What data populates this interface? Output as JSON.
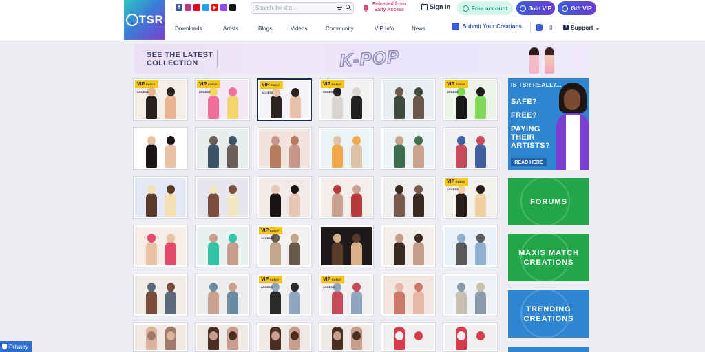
{
  "header": {
    "logo_text": "TSR",
    "search_placeholder": "Search the site...",
    "early_access": [
      "Released from",
      "Early Access"
    ],
    "sign_in": "Sign In",
    "free_account": "Free account",
    "join_vip": "Join VIP",
    "gift_vip": "Gift VIP",
    "nav": [
      "Downloads",
      "Artists",
      "Blogs",
      "Videos",
      "Community",
      "VIP Info",
      "News"
    ],
    "submit": "Submit Your Creations",
    "coins": "0",
    "support": "Support",
    "socials": [
      "facebook-icon",
      "instagram-icon",
      "pinterest-icon",
      "twitter-icon",
      "youtube-icon",
      "twitch-icon",
      "tiktok-icon"
    ]
  },
  "banner": {
    "line1": "SEE THE LATEST",
    "line2": "COLLECTION",
    "title": "K-POP"
  },
  "tiles": [
    {
      "vip": true
    },
    {
      "vip": true
    },
    {
      "vip": true,
      "selected": true
    },
    {
      "vip": true
    },
    {
      "vip": false
    },
    {
      "vip": true
    },
    {
      "vip": false
    },
    {
      "vip": false
    },
    {
      "vip": false
    },
    {
      "vip": false
    },
    {
      "vip": false
    },
    {
      "vip": false
    },
    {
      "vip": false
    },
    {
      "vip": false
    },
    {
      "vip": false
    },
    {
      "vip": false
    },
    {
      "vip": false
    },
    {
      "vip": true
    },
    {
      "vip": false
    },
    {
      "vip": false
    },
    {
      "vip": true
    },
    {
      "vip": false
    },
    {
      "vip": false
    },
    {
      "vip": false
    },
    {
      "vip": false
    },
    {
      "vip": false
    },
    {
      "vip": true
    },
    {
      "vip": true
    },
    {
      "vip": false
    },
    {
      "vip": false
    },
    {
      "vip": false
    },
    {
      "vip": false
    },
    {
      "vip": false
    },
    {
      "vip": false
    },
    {
      "vip": false
    },
    {
      "vip": false
    }
  ],
  "vip_badge": "VIP",
  "vip_badge_small": "EARLY ACCESS",
  "ad": {
    "top": "IS TSR REALLY...",
    "safe": "SAFE?",
    "free": "FREE?",
    "paying": [
      "PAYING",
      "THEIR",
      "ARTISTS?"
    ],
    "button": "READ HERE"
  },
  "sidebar": {
    "forums": "FORUMS",
    "maxis": [
      "MAXIS MATCH",
      "CREATIONS"
    ],
    "trending": [
      "TRENDING",
      "CREATIONS"
    ]
  },
  "privacy": "Privacy",
  "colors": {
    "accent": "#3b5bd8",
    "green": "#22a64a",
    "blue": "#2f86d0",
    "vip": "#f5c518"
  }
}
